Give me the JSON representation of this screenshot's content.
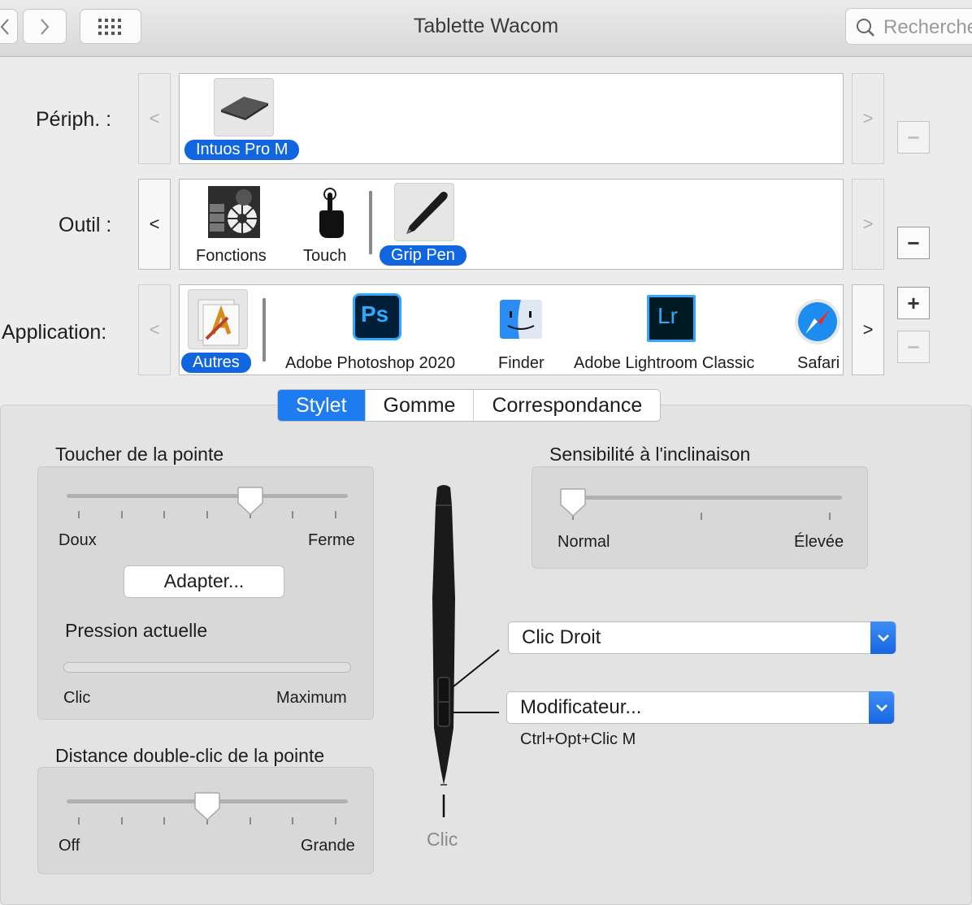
{
  "window": {
    "title": "Tablette Wacom"
  },
  "search": {
    "placeholder": "Recherche"
  },
  "rows": {
    "device": {
      "label": "Périph. :",
      "items": [
        {
          "label": "Intuos Pro M",
          "selected": true
        }
      ]
    },
    "tool": {
      "label": "Outil :",
      "items": [
        {
          "label": "Fonctions"
        },
        {
          "label": "Touch"
        },
        {
          "label": "Grip Pen",
          "selected": true
        }
      ]
    },
    "application": {
      "label": "Application:",
      "items": [
        {
          "label": "Autres",
          "selected": true
        },
        {
          "label": "Adobe Photoshop 2020",
          "icon_text": "Ps"
        },
        {
          "label": "Finder"
        },
        {
          "label": "Adobe Lightroom Classic",
          "icon_text": "Lr"
        },
        {
          "label": "Safari"
        }
      ]
    }
  },
  "tabs": [
    "Stylet",
    "Gomme",
    "Correspondance"
  ],
  "selected_tab": "Stylet",
  "tip_feel": {
    "title": "Toucher de la pointe",
    "min_label": "Doux",
    "max_label": "Ferme",
    "level_fraction": 0.65,
    "customize_button": "Adapter...",
    "current_pressure_title": "Pression actuelle",
    "pressure_min_label": "Clic",
    "pressure_max_label": "Maximum",
    "pressure_fraction": 0
  },
  "double_click": {
    "title": "Distance double-clic de la pointe",
    "min_label": "Off",
    "max_label": "Grande",
    "level_fraction": 0.5
  },
  "tilt": {
    "title": "Sensibilité à l'inclinaison",
    "min_label": "Normal",
    "max_label": "Élevée",
    "level_fraction": 0
  },
  "pen_buttons": {
    "upper": "Clic Droit",
    "lower": "Modificateur...",
    "lower_detail": "Ctrl+Opt+Clic M",
    "tip_label": "Clic"
  },
  "colors": {
    "accent": "#1166e0",
    "photoshop": "#31a8ff",
    "lightroom": "#31a8ff"
  }
}
